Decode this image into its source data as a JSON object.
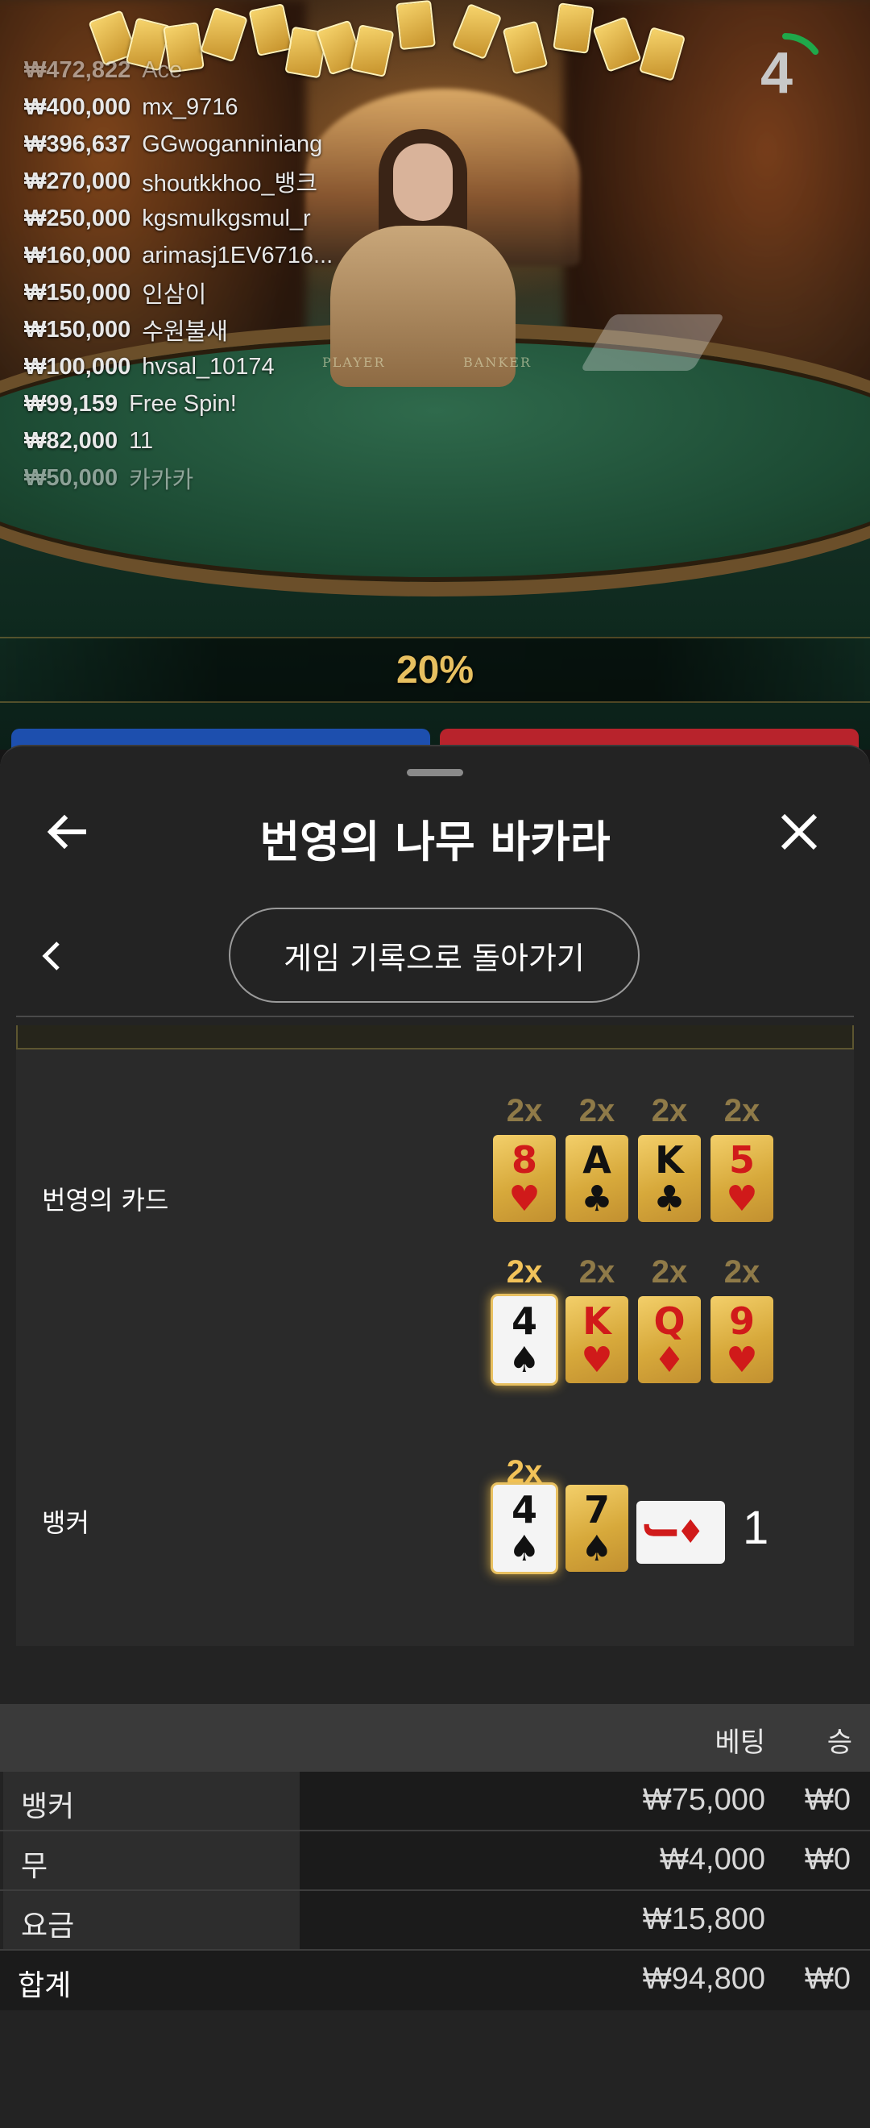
{
  "leaderboard": [
    {
      "amount": "₩472,822",
      "name": "Ace"
    },
    {
      "amount": "₩400,000",
      "name": "mx_9716"
    },
    {
      "amount": "₩396,637",
      "name": "GGwoganniniang"
    },
    {
      "amount": "₩270,000",
      "name": "shoutkkhoo_뱅크"
    },
    {
      "amount": "₩250,000",
      "name": "kgsmulkgsmul_r"
    },
    {
      "amount": "₩160,000",
      "name": "arimasj1EV6716..."
    },
    {
      "amount": "₩150,000",
      "name": "인삼이"
    },
    {
      "amount": "₩150,000",
      "name": "수원불새"
    },
    {
      "amount": "₩100,000",
      "name": "hvsal_10174"
    },
    {
      "amount": "₩99,159",
      "name": "Free Spin!"
    },
    {
      "amount": "₩82,000",
      "name": "11"
    },
    {
      "amount": "₩50,000",
      "name": "카카카"
    }
  ],
  "timer": {
    "value": "4",
    "progress": 0.15,
    "color": "#1fa84a"
  },
  "table_felt": {
    "player": "PLAYER",
    "banker": "BANKER"
  },
  "percent": "20%",
  "sheet": {
    "title": "번영의 나무 바카라",
    "back_icon": "arrow-left-icon",
    "close_icon": "close-icon",
    "history_button": "게임 기록으로 돌아가기"
  },
  "round": {
    "prosperity_label": "번영의 카드",
    "prosperity_rows": [
      [
        {
          "mult": "2x",
          "rank": "8",
          "suit": "♥",
          "red": true,
          "lit": false
        },
        {
          "mult": "2x",
          "rank": "A",
          "suit": "♣",
          "red": false,
          "lit": false
        },
        {
          "mult": "2x",
          "rank": "K",
          "suit": "♣",
          "red": false,
          "lit": false
        },
        {
          "mult": "2x",
          "rank": "5",
          "suit": "♥",
          "red": true,
          "lit": false
        }
      ],
      [
        {
          "mult": "2x",
          "rank": "4",
          "suit": "♠",
          "red": false,
          "lit": true
        },
        {
          "mult": "2x",
          "rank": "K",
          "suit": "♥",
          "red": true,
          "lit": false
        },
        {
          "mult": "2x",
          "rank": "Q",
          "suit": "♦",
          "red": true,
          "lit": false
        },
        {
          "mult": "2x",
          "rank": "9",
          "suit": "♥",
          "red": true,
          "lit": false
        }
      ]
    ],
    "banker_label": "뱅커",
    "banker_mult": "2x",
    "banker_cards": [
      {
        "rank": "4",
        "suit": "♠",
        "red": false,
        "lit": true
      },
      {
        "rank": "7",
        "suit": "♠",
        "red": false,
        "lit": false
      }
    ],
    "banker_side_card": {
      "rank": "J",
      "suit": "♦"
    },
    "banker_score": "1"
  },
  "bets": {
    "headers": {
      "bet": "베팅",
      "win": "승"
    },
    "rows": [
      {
        "label": "뱅커",
        "bet": "₩75,000",
        "win": "₩0"
      },
      {
        "label": "무",
        "bet": "₩4,000",
        "win": "₩0"
      },
      {
        "label": "요금",
        "bet": "₩15,800",
        "win": ""
      }
    ],
    "total": {
      "label": "합계",
      "bet": "₩94,800",
      "win": "₩0"
    }
  }
}
